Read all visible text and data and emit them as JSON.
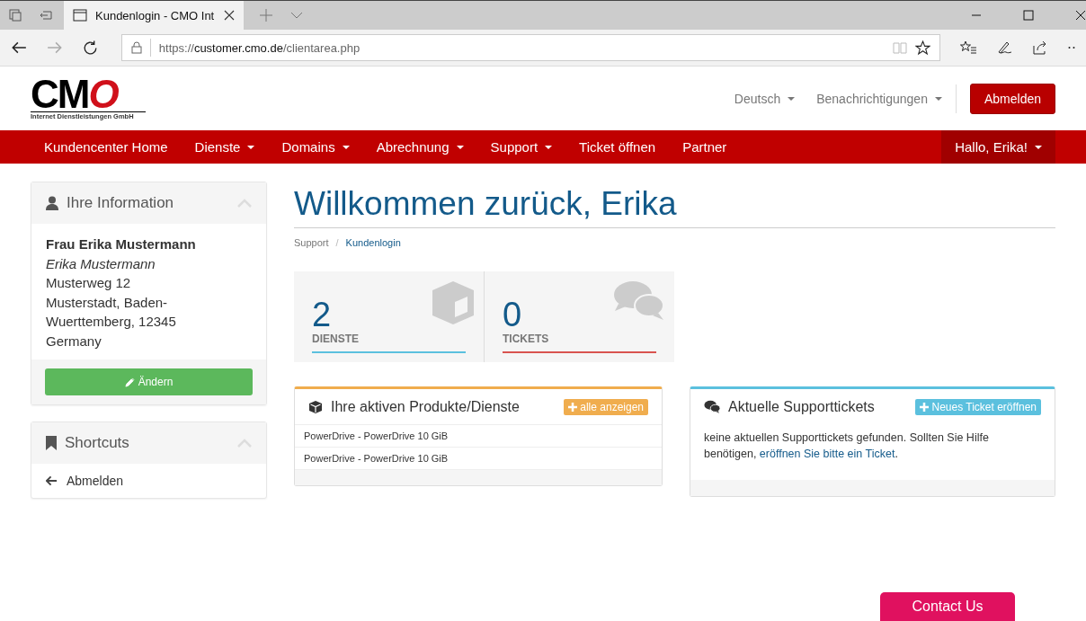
{
  "browser": {
    "tab_title": "Kundenlogin - CMO Int",
    "url_scheme": "https://",
    "url_host": "customer.cmo.de",
    "url_path": "/clientarea.php"
  },
  "logo": {
    "mark": "CMO",
    "subtitle": "Internet Dienstleistungen GmbH"
  },
  "header_links": [
    {
      "label": "Deutsch",
      "dropdown": true
    },
    {
      "label": "Benachrichtigungen",
      "dropdown": true
    }
  ],
  "logout_button": "Abmelden",
  "nav": [
    {
      "label": "Kundencenter Home",
      "dropdown": false
    },
    {
      "label": "Dienste",
      "dropdown": true
    },
    {
      "label": "Domains",
      "dropdown": true
    },
    {
      "label": "Abrechnung",
      "dropdown": true
    },
    {
      "label": "Support",
      "dropdown": true
    },
    {
      "label": "Ticket öffnen",
      "dropdown": false
    },
    {
      "label": "Partner",
      "dropdown": false
    }
  ],
  "user_menu": {
    "label": "Hallo, Erika!",
    "dropdown": true
  },
  "info_panel": {
    "title": "Ihre Information",
    "name": "Frau Erika Mustermann",
    "company": "Erika Mustermann",
    "lines": [
      "Musterweg 12",
      "Musterstadt, Baden-",
      "Wuerttemberg, 12345",
      "Germany"
    ],
    "button": "Ändern"
  },
  "shortcuts_panel": {
    "title": "Shortcuts",
    "items": [
      "Abmelden"
    ]
  },
  "page_title": "Willkommen zurück, Erika",
  "breadcrumb": [
    {
      "label": "Support",
      "selected": false
    },
    {
      "label": "Kundenlogin",
      "selected": true,
      "separator": "/"
    }
  ],
  "tiles": [
    {
      "kind": "box",
      "count": "2",
      "label": "DIENSTE",
      "color": "#5bc0de"
    },
    {
      "kind": "chat",
      "count": "0",
      "label": "TICKETS",
      "color": "#d9534f"
    }
  ],
  "products_panel": {
    "title": "Ihre aktiven Produkte/Dienste",
    "button": "alle anzeigen",
    "rows": [
      "PowerDrive - PowerDrive 10 GiB",
      "PowerDrive - PowerDrive 10 GiB"
    ]
  },
  "tickets_panel": {
    "title": "Aktuelle Supporttickets",
    "button": "Neues Ticket eröffnen",
    "text": "keine aktuellen Supporttickets gefunden. Sollten Sie Hilfe benötigen,",
    "link": "eröffnen Sie bitte ein Ticket",
    "text_end": "."
  },
  "contact_button": "Contact Us"
}
